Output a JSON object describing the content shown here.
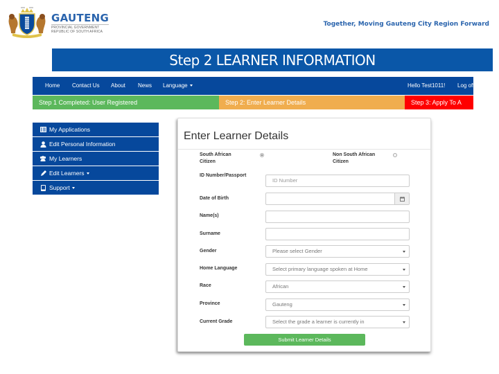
{
  "header": {
    "brand_name": "GAUTENG",
    "brand_sub1": "PROVINCIAL GOVERNMENT",
    "brand_sub2": "REPUBLIC OF SOUTH AFRICA",
    "tagline": "Together, Moving Gauteng City Region Forward"
  },
  "slide_title": "Step 2 LEARNER INFORMATION",
  "navbar": {
    "items": [
      {
        "label": "Home"
      },
      {
        "label": "Contact Us"
      },
      {
        "label": "About"
      },
      {
        "label": "News"
      },
      {
        "label": "Language"
      }
    ],
    "greeting": "Hello Test1011!",
    "logoff": "Log off"
  },
  "steps": [
    {
      "label": "Step 1 Completed: User Registered",
      "color": "#5cb85c"
    },
    {
      "label": "Step 2: Enter Learner Details",
      "color": "#f0ad4e"
    },
    {
      "label": "Step 3: Apply To A",
      "color": "#ff0000"
    }
  ],
  "sidebar": {
    "items": [
      {
        "label": "My Applications",
        "icon": "list-alt-icon"
      },
      {
        "label": "Edit Personal Information",
        "icon": "user-icon"
      },
      {
        "label": "My Learners",
        "icon": "users-icon"
      },
      {
        "label": "Edit Learners",
        "icon": "pencil-icon"
      },
      {
        "label": "Support",
        "icon": "phone-icon"
      }
    ]
  },
  "form": {
    "title": "Enter Learner Details",
    "citizenship": {
      "sa_label_1": "South African",
      "sa_label_2": "Citizen",
      "nsa_label_1": "Non South African",
      "nsa_label_2": "Citizen",
      "selected": "South African Citizen"
    },
    "id_label": "ID Number/Passport",
    "id_placeholder": "ID Number",
    "dob_label": "Date of Birth",
    "dob_value": "",
    "names_label": "Name(s)",
    "names_value": "",
    "surname_label": "Surname",
    "surname_value": "",
    "gender_label": "Gender",
    "gender_value": "Please select Gender",
    "language_label": "Home Language",
    "language_value": "Select primary language spoken at Home",
    "race_label": "Race",
    "race_value": "African",
    "province_label": "Province",
    "province_value": "Gauteng",
    "grade_label": "Current Grade",
    "grade_value": "Select the grade a learner is currently in",
    "submit_label": "Submit Learner Details"
  },
  "colors": {
    "primary_blue": "#06489c",
    "title_blue": "#0a57a8",
    "success_green": "#5cb85c",
    "warning_orange": "#f0ad4e",
    "danger_red": "#ff0000"
  }
}
